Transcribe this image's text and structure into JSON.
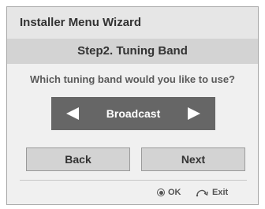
{
  "window": {
    "title": "Installer Menu Wizard",
    "step_title": "Step2. Tuning Band",
    "question": "Which tuning band would you like to use?"
  },
  "selector": {
    "value": "Broadcast",
    "left_icon": "triangle-left-icon",
    "right_icon": "triangle-right-icon"
  },
  "buttons": {
    "back": "Back",
    "next": "Next"
  },
  "footer": {
    "ok_label": "OK",
    "ok_icon": "ok-circle-icon",
    "exit_label": "Exit",
    "exit_icon": "return-arrow-icon"
  },
  "colors": {
    "panel": "#f0f0f0",
    "title_bar": "#e6e6e6",
    "step_bar": "#d3d3d3",
    "selector": "#666666",
    "button": "#d3d3d3"
  }
}
